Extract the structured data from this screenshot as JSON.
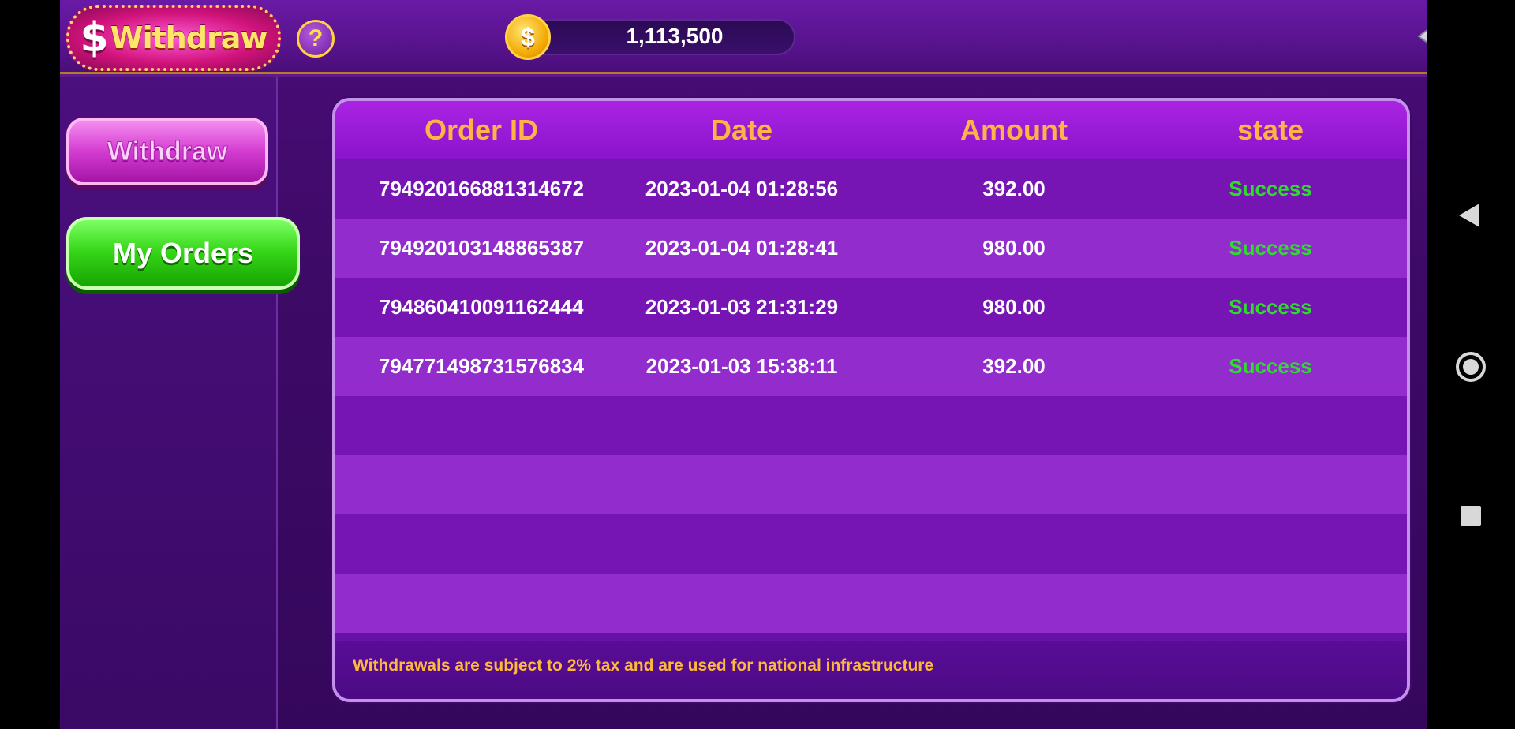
{
  "header": {
    "logo_symbol": "$",
    "logo_title": "Withdraw",
    "help_symbol": "?",
    "coin_symbol": "$",
    "balance": "1,113,500"
  },
  "menu": {
    "items": [
      {
        "label": "Withdraw",
        "active": false
      },
      {
        "label": "My Orders",
        "active": true
      }
    ]
  },
  "orders": {
    "columns": [
      "Order ID",
      "Date",
      "Amount",
      "state"
    ],
    "rows": [
      {
        "order_id": "794920166881314672",
        "date": "2023-01-04 01:28:56",
        "amount": "392.00",
        "state": "Success"
      },
      {
        "order_id": "794920103148865387",
        "date": "2023-01-04 01:28:41",
        "amount": "980.00",
        "state": "Success"
      },
      {
        "order_id": "794860410091162444",
        "date": "2023-01-03 21:31:29",
        "amount": "980.00",
        "state": "Success"
      },
      {
        "order_id": "794771498731576834",
        "date": "2023-01-03 15:38:11",
        "amount": "392.00",
        "state": "Success"
      }
    ],
    "note": "Withdrawals are subject to 2% tax and are used for national infrastructure"
  },
  "colors": {
    "header_text": "#ffb245",
    "success": "#2edc2e",
    "note_text": "#ffb93a"
  },
  "icons": {
    "help": "question-icon",
    "coin": "gold-coin-icon",
    "back": "return-arrow-icon",
    "nav_back": "triangle-back-icon",
    "nav_home": "circle-home-icon",
    "nav_recent": "square-recent-icon"
  }
}
